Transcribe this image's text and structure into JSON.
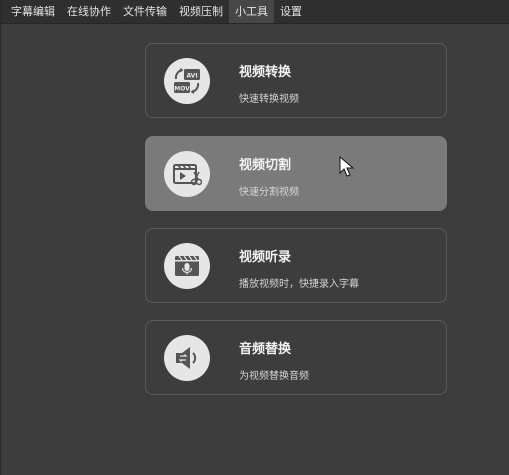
{
  "menubar": {
    "items": [
      {
        "label": "字幕编辑"
      },
      {
        "label": "在线协作"
      },
      {
        "label": "文件传输"
      },
      {
        "label": "视频压制"
      },
      {
        "label": "小工具"
      },
      {
        "label": "设置"
      }
    ],
    "active_index": 4
  },
  "tools": [
    {
      "title": "视频转换",
      "desc": "快速转换视频",
      "icon": "video-convert-icon",
      "icon_text_top": "AVI",
      "icon_text_bottom": "MOV"
    },
    {
      "title": "视频切割",
      "desc": "快速分割视频",
      "icon": "video-cut-icon",
      "highlighted": true
    },
    {
      "title": "视频听录",
      "desc": "播放视频时，快捷录入字幕",
      "icon": "video-transcribe-icon"
    },
    {
      "title": "音频替换",
      "desc": "为视频替换音频",
      "icon": "audio-replace-icon"
    }
  ],
  "colors": {
    "background": "#3d3d3d",
    "menubar": "#2f2f2f",
    "card_highlight": "#7a7a7a",
    "icon_bg": "#e6e6e6",
    "icon_fg": "#555555"
  }
}
